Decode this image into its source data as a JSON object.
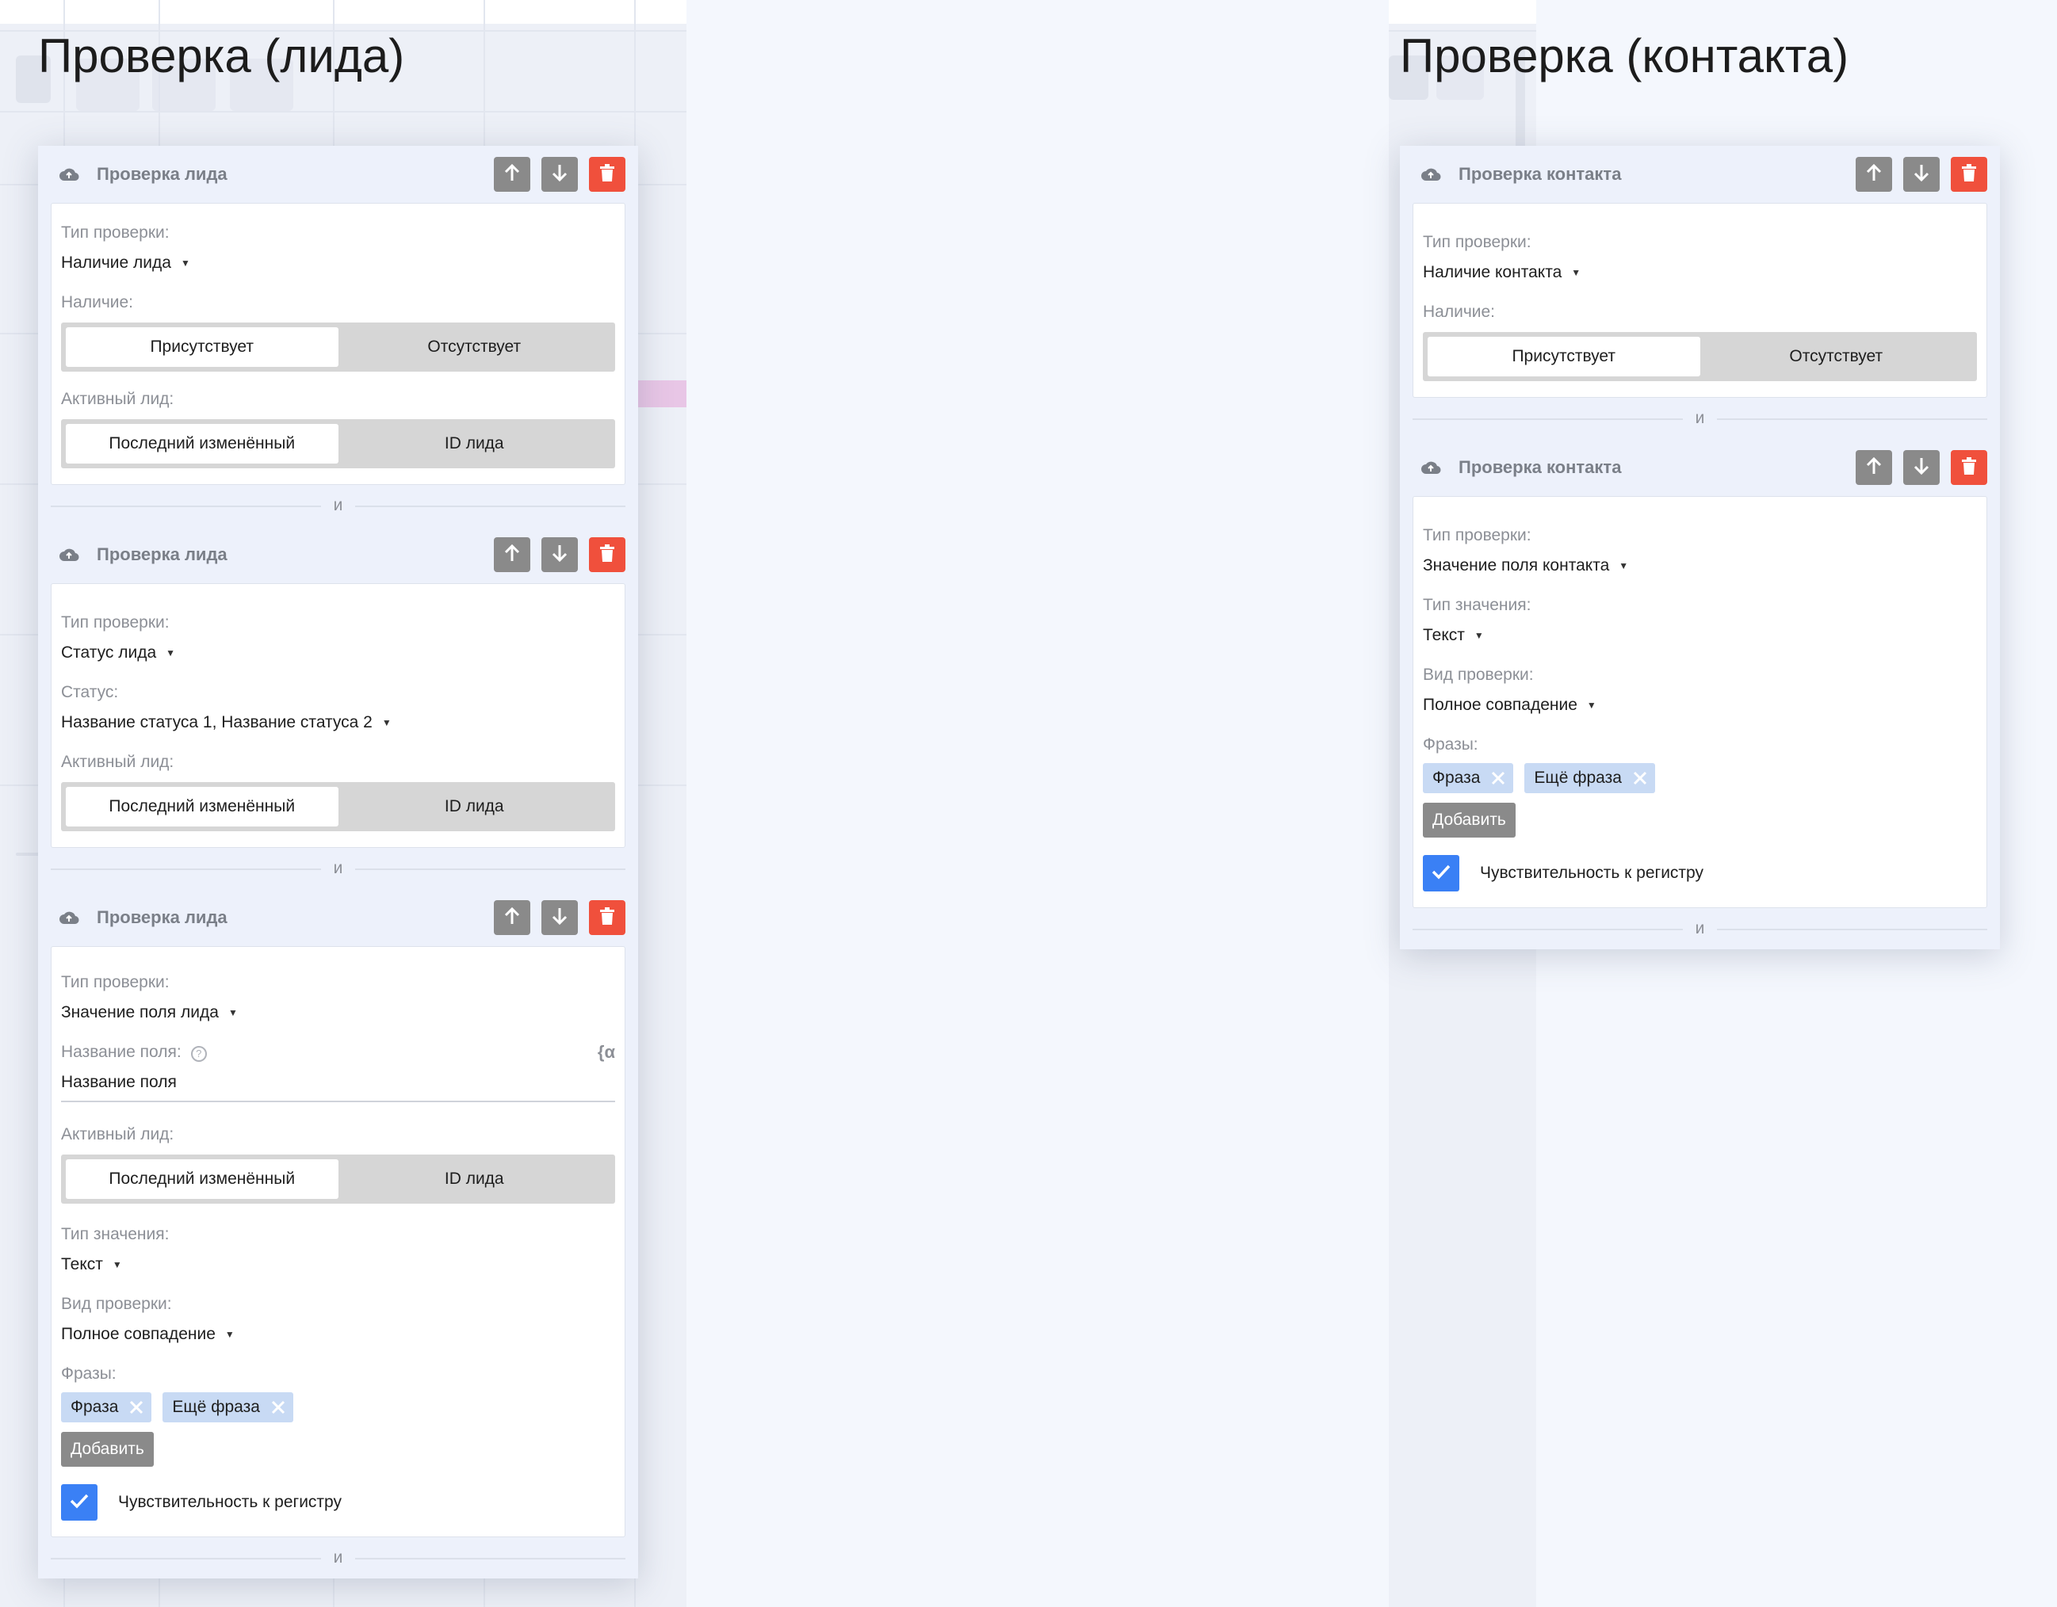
{
  "lead": {
    "page_title": "Проверка (лида)",
    "cards": [
      {
        "title": "Проверка лида",
        "check_type_label": "Тип проверки:",
        "check_type_value": "Наличие лида",
        "presence_label": "Наличие:",
        "presence_options": [
          "Присутствует",
          "Отсутствует"
        ],
        "active_label": "Активный лид:",
        "active_options": [
          "Последний изменённый",
          "ID лида"
        ]
      },
      {
        "title": "Проверка лида",
        "check_type_label": "Тип проверки:",
        "check_type_value": "Статус лида",
        "status_label": "Статус:",
        "status_value": "Название статуса 1, Название статуса 2",
        "active_label": "Активный лид:",
        "active_options": [
          "Последний изменённый",
          "ID лида"
        ]
      },
      {
        "title": "Проверка лида",
        "check_type_label": "Тип проверки:",
        "check_type_value": "Значение поля лида",
        "field_name_label": "Название поля:",
        "field_name_help": "?",
        "field_var_icon": "{α",
        "field_name_value": "Название поля",
        "active_label": "Активный лид:",
        "active_options": [
          "Последний изменённый",
          "ID лида"
        ],
        "value_type_label": "Тип значения:",
        "value_type_value": "Текст",
        "match_label": "Вид проверки:",
        "match_value": "Полное совпадение",
        "phrases_label": "Фразы:",
        "phrases": [
          "Фраза",
          "Ещё фраза"
        ],
        "add_label": "Добавить",
        "case_label": "Чувствительность к регистру",
        "case_checked": true
      }
    ],
    "separator": "и"
  },
  "contact": {
    "page_title": "Проверка (контакта)",
    "cards": [
      {
        "title": "Проверка контакта",
        "check_type_label": "Тип проверки:",
        "check_type_value": "Наличие контакта",
        "presence_label": "Наличие:",
        "presence_options": [
          "Присутствует",
          "Отсутствует"
        ]
      },
      {
        "title": "Проверка контакта",
        "check_type_label": "Тип проверки:",
        "check_type_value": "Значение поля контакта",
        "value_type_label": "Тип значения:",
        "value_type_value": "Текст",
        "match_label": "Вид проверки:",
        "match_value": "Полное совпадение",
        "phrases_label": "Фразы:",
        "phrases": [
          "Фраза",
          "Ещё фраза"
        ],
        "add_label": "Добавить",
        "case_label": "Чувствительность к регистру",
        "case_checked": true
      }
    ],
    "separator": "и"
  },
  "icons": {
    "card_icon": "cloud-icon",
    "move_up": "arrow-up-icon",
    "move_down": "arrow-down-icon",
    "delete": "trash-icon",
    "tag_remove": "close-icon",
    "checkbox": "check-icon"
  },
  "colors": {
    "delete_button": "#f0503c",
    "neutral_button": "#8a8a8a",
    "checkbox": "#3a80f5",
    "tag": "#c8daf4",
    "panel": "#edf1fb"
  }
}
